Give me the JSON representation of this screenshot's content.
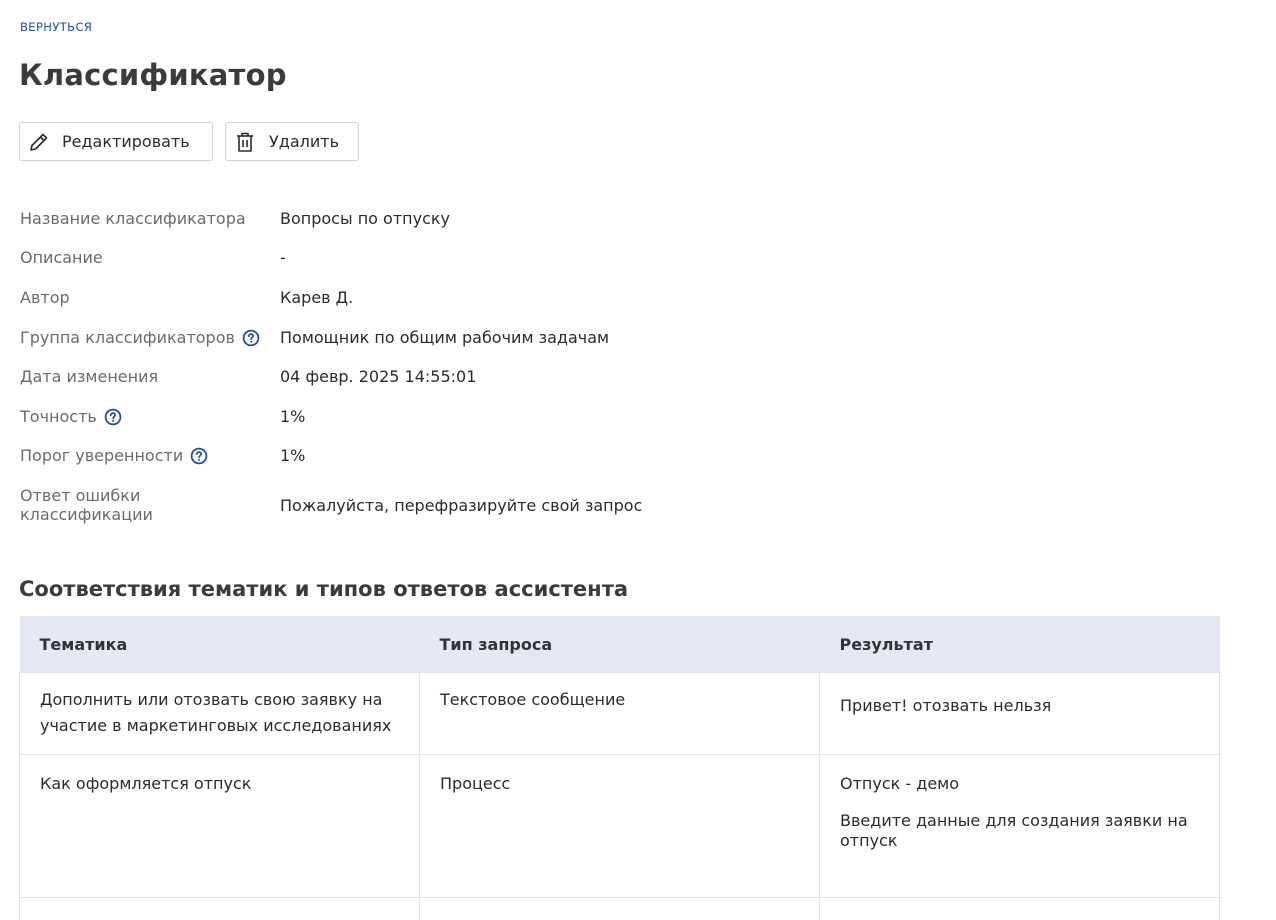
{
  "nav": {
    "back_label": "ВЕРНУТЬСЯ"
  },
  "page": {
    "title": "Классификатор"
  },
  "toolbar": {
    "edit_label": "Редактировать",
    "delete_label": "Удалить"
  },
  "properties": [
    {
      "label": "Название классификатора",
      "value": "Вопросы по отпуску",
      "help": false
    },
    {
      "label": "Описание",
      "value": "-",
      "help": false
    },
    {
      "label": "Автор",
      "value": "Карев Д.",
      "help": false
    },
    {
      "label": "Группа классификаторов",
      "value": "Помощник по общим рабочим задачам",
      "help": true
    },
    {
      "label": "Дата изменения",
      "value": "04 февр. 2025 14:55:01",
      "help": false
    },
    {
      "label": "Точность",
      "value": "1%",
      "help": true
    },
    {
      "label": "Порог уверенности",
      "value": "1%",
      "help": true
    },
    {
      "label": "Ответ ошибки классификации",
      "value": "Пожалуйста, перефразируйте свой запрос",
      "help": false
    }
  ],
  "section": {
    "title": "Соответствия тематик и типов ответов ассистента"
  },
  "table": {
    "headers": [
      "Тематика",
      "Тип запроса",
      "Результат"
    ],
    "rows": [
      {
        "topic": "Дополнить или отозвать свою заявку на участие в маркетинговых исследованиях",
        "type": "Текстовое сообщение",
        "result": [
          "Привет! отозвать нельзя"
        ]
      },
      {
        "topic": "Как оформляется отпуск",
        "type": "Процесс",
        "result": [
          "Отпуск - демо",
          "Введите данные для создания заявки на отпуск"
        ]
      },
      {
        "topic": "",
        "type": "",
        "result": []
      }
    ]
  },
  "colors": {
    "link": "#1d4fa3",
    "help_icon": "#1d4fa3",
    "table_header_bg": "#e4e8f0"
  },
  "icons": {
    "edit": "pencil-icon",
    "delete": "trash-icon",
    "help": "question-circle-icon"
  }
}
